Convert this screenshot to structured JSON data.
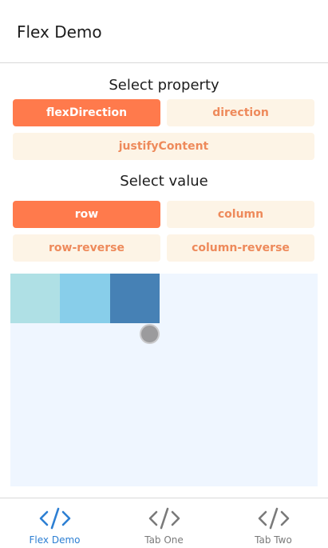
{
  "header": {
    "title": "Flex Demo"
  },
  "property_section": {
    "label": "Select property",
    "options": [
      "flexDirection",
      "direction",
      "justifyContent"
    ],
    "selected": "flexDirection"
  },
  "value_section": {
    "label": "Select value",
    "options": [
      "row",
      "column",
      "row-reverse",
      "column-reverse"
    ],
    "selected": "row"
  },
  "preview": {
    "box_colors": [
      "#afe0e5",
      "#88ceea",
      "#4681b5"
    ],
    "background": "#eff6ff"
  },
  "tabs": [
    {
      "label": "Flex Demo",
      "icon": "code-icon",
      "active": true
    },
    {
      "label": "Tab One",
      "icon": "code-icon",
      "active": false
    },
    {
      "label": "Tab Two",
      "icon": "code-icon",
      "active": false
    }
  ],
  "colors": {
    "accent": "#ff7a4c",
    "option_bg": "#fdf4e6",
    "option_text": "#ee8a5b",
    "tab_active": "#2d7fd3",
    "tab_inactive": "#7a7a7a"
  }
}
